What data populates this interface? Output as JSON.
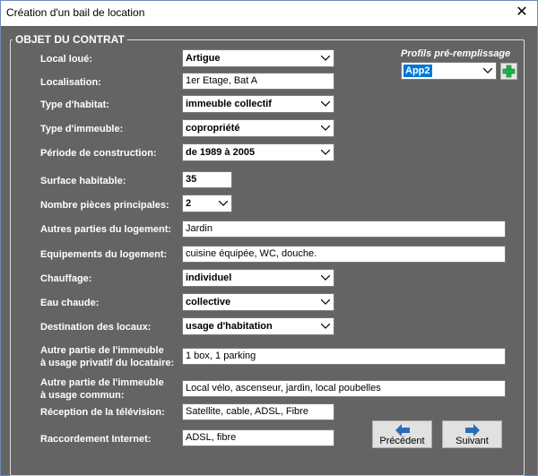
{
  "window": {
    "title": "Création d'un bail de location",
    "close_glyph": "✕"
  },
  "group": {
    "title": "OBJET DU CONTRAT"
  },
  "profiles": {
    "label": "Profils pré-remplissage",
    "selected": "App2",
    "add_icon": "green-plus-icon"
  },
  "fields": {
    "local_loue": {
      "label": "Local loué:",
      "value": "Artigue"
    },
    "localisation": {
      "label": "Localisation:",
      "value": "1er Etage, Bat A"
    },
    "type_habitat": {
      "label": "Type d'habitat:",
      "value": "immeuble collectif"
    },
    "type_immeuble": {
      "label": "Type d'immeuble:",
      "value": "copropriété"
    },
    "periode": {
      "label": "Période de construction:",
      "value": "de 1989 à 2005"
    },
    "surface": {
      "label": "Surface habitable:",
      "value": "35"
    },
    "pieces": {
      "label": "Nombre pièces principales:",
      "value": "2"
    },
    "autres_parties": {
      "label": "Autres parties du logement:",
      "value": "Jardin"
    },
    "equipements": {
      "label": "Equipements du logement:",
      "value": "cuisine équipée, WC, douche."
    },
    "chauffage": {
      "label": "Chauffage:",
      "value": "individuel"
    },
    "eau_chaude": {
      "label": "Eau chaude:",
      "value": "collective"
    },
    "destination": {
      "label": "Destination des locaux:",
      "value": "usage d'habitation"
    },
    "partie_privatif": {
      "label_line1": "Autre partie de l'immeuble",
      "label_line2": "à usage privatif du locataire:",
      "value": "1 box, 1 parking"
    },
    "partie_commun": {
      "label_line1": "Autre partie de l'immeuble",
      "label_line2": "à usage commun:",
      "value": "Local vélo, ascenseur, jardin, local poubelles"
    },
    "television": {
      "label": "Réception de la télévision:",
      "value": "Satellite, cable, ADSL, Fibre"
    },
    "internet": {
      "label": "Raccordement Internet:",
      "value": "ADSL, fibre"
    }
  },
  "buttons": {
    "previous": "Précédent",
    "next": "Suivant"
  },
  "colors": {
    "background": "#646464",
    "arrow_blue": "#2b6cb8",
    "plus_green": "#22b14c"
  }
}
